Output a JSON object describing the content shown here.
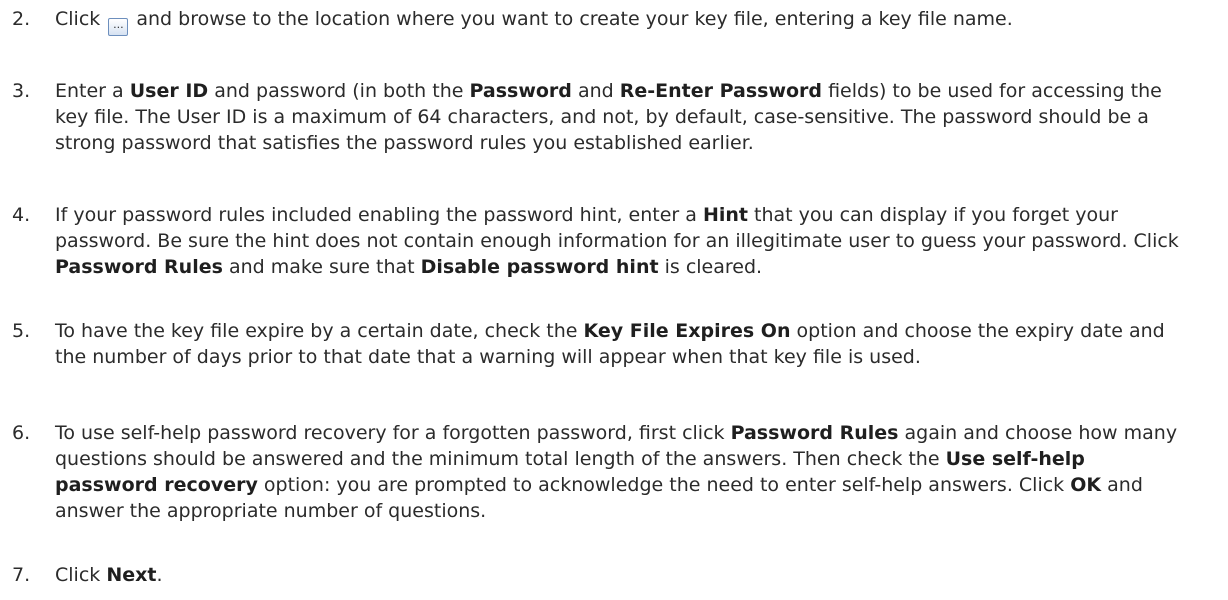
{
  "steps": [
    {
      "number": "2.",
      "parts": [
        {
          "t": "Click ",
          "b": false
        },
        {
          "icon": "browse-button-icon",
          "label": "..."
        },
        {
          "t": " and browse to the location where you want to create your key file, entering a key file name.",
          "b": false
        }
      ]
    },
    {
      "number": "3.",
      "parts": [
        {
          "t": "Enter a ",
          "b": false
        },
        {
          "t": "User ID",
          "b": true
        },
        {
          "t": " and password (in both the ",
          "b": false
        },
        {
          "t": "Password",
          "b": true
        },
        {
          "t": " and ",
          "b": false
        },
        {
          "t": "Re-Enter Password",
          "b": true
        },
        {
          "t": " fields) to be used for accessing the key file. The User ID is a maximum of 64 characters, and not, by default, case-sensitive. The password should be a strong password that satisfies the password rules you established earlier.",
          "b": false
        }
      ]
    },
    {
      "number": "4.",
      "parts": [
        {
          "t": "If your password rules included enabling the password hint, enter a ",
          "b": false
        },
        {
          "t": "Hint",
          "b": true
        },
        {
          "t": " that you can display if you forget your password. Be sure the hint does not contain enough information for an illegitimate user to guess your password. Click ",
          "b": false
        },
        {
          "t": "Password Rules",
          "b": true
        },
        {
          "t": " and make sure that ",
          "b": false
        },
        {
          "t": "Disable password hint",
          "b": true
        },
        {
          "t": " is cleared.",
          "b": false
        }
      ]
    },
    {
      "number": "5.",
      "parts": [
        {
          "t": "To have the key file expire by a certain date, check the ",
          "b": false
        },
        {
          "t": "Key File Expires On",
          "b": true
        },
        {
          "t": " option and choose the expiry date and the number of days prior to that date that a warning will appear when that key file is used.",
          "b": false
        }
      ]
    },
    {
      "number": "6.",
      "parts": [
        {
          "t": "To use self-help password recovery for a forgotten password, first click ",
          "b": false
        },
        {
          "t": "Password Rules",
          "b": true
        },
        {
          "t": " again and choose how many questions should be answered and the minimum total length of the answers. Then check the ",
          "b": false
        },
        {
          "t": "Use self-help password recovery",
          "b": true
        },
        {
          "t": " option: you are prompted to acknowledge the need to enter self-help answers. Click ",
          "b": false
        },
        {
          "t": "OK",
          "b": true
        },
        {
          "t": " and answer the appropriate number of questions.",
          "b": false
        }
      ]
    },
    {
      "number": "7.",
      "parts": [
        {
          "t": "Click ",
          "b": false
        },
        {
          "t": "Next",
          "b": true
        },
        {
          "t": ".",
          "b": false
        }
      ]
    }
  ]
}
